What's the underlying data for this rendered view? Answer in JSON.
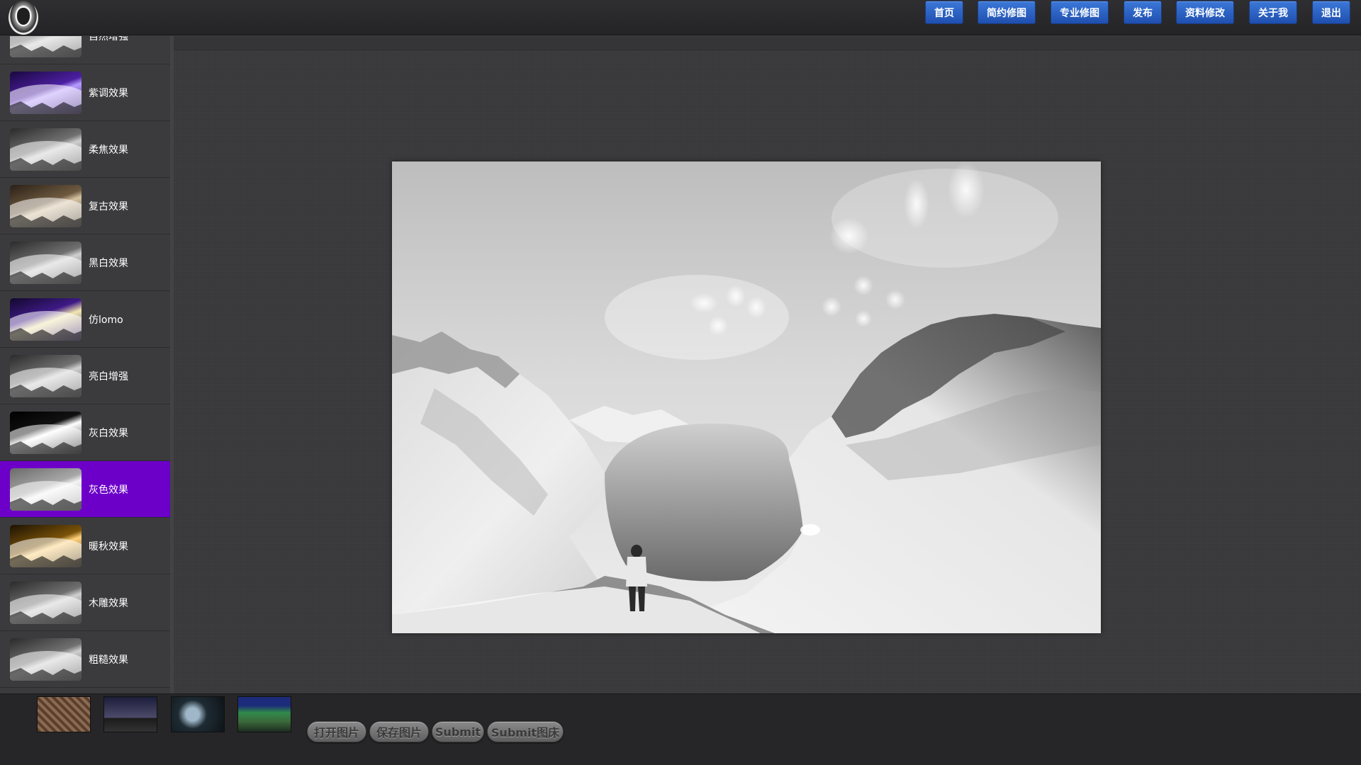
{
  "header": {
    "logo": "portrait-logo",
    "nav": [
      {
        "id": "home",
        "label": "首页"
      },
      {
        "id": "simple",
        "label": "简约修图"
      },
      {
        "id": "pro",
        "label": "专业修图"
      },
      {
        "id": "publish",
        "label": "发布"
      },
      {
        "id": "profile",
        "label": "资料修改"
      },
      {
        "id": "about",
        "label": "关于我"
      },
      {
        "id": "logout",
        "label": "退出"
      }
    ],
    "nav_color": "#2a5fc1"
  },
  "sidebar": {
    "active_index": 8,
    "active_color": "#6c00c9",
    "items": [
      {
        "label": "自然增强",
        "tint": "gray"
      },
      {
        "label": "紫调效果",
        "tint": "purple"
      },
      {
        "label": "柔焦效果",
        "tint": "gray"
      },
      {
        "label": "复古效果",
        "tint": "sepia"
      },
      {
        "label": "黑白效果",
        "tint": "gray"
      },
      {
        "label": "仿lomo",
        "tint": "purple-yellow"
      },
      {
        "label": "亮白增强",
        "tint": "gray"
      },
      {
        "label": "灰白效果",
        "tint": "bw-high"
      },
      {
        "label": "灰色效果",
        "tint": "light-gray"
      },
      {
        "label": "暖秋效果",
        "tint": "gold"
      },
      {
        "label": "木雕效果",
        "tint": "gray"
      },
      {
        "label": "粗糙效果",
        "tint": "gray"
      }
    ]
  },
  "main": {
    "image": "grayscale-fjord-photo"
  },
  "footer": {
    "recent": [
      {
        "name": "recent-thumb-1",
        "style": "brown-pattern"
      },
      {
        "name": "recent-thumb-2",
        "style": "night-sky"
      },
      {
        "name": "recent-thumb-3",
        "style": "underwater"
      },
      {
        "name": "recent-thumb-4",
        "style": "green-landscape"
      }
    ],
    "buttons": [
      {
        "id": "open",
        "label": "打开图片"
      },
      {
        "id": "save",
        "label": "保存图片"
      },
      {
        "id": "submit",
        "label": "Submit"
      },
      {
        "id": "submit-bed",
        "label": "Submit图床"
      }
    ]
  }
}
